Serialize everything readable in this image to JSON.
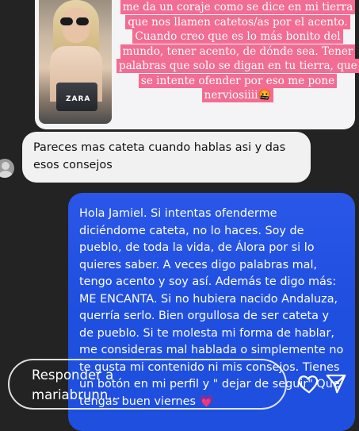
{
  "story_image": {
    "watermark": "ZARA",
    "overlay_text": "me da un coraje como se dice en mi tierra que nos llamen catetos/as por el acento. Cuando creo que es lo más bonito del mundo, tener acento, de dónde sea. Tener palabras que solo se digan en tu tierra, que se intente ofender por eso me pone nerviosiiii🤬"
  },
  "received_message": {
    "text": "Pareces mas cateta cuando hablas asi y das esos consejos"
  },
  "sent_message": {
    "text": "Hola Jamiel. Si intentas ofenderme diciéndome cateta, no lo haces. Soy de pueblo, de toda la vida, de Álora por si lo quieres saber. A veces digo palabras mal, tengo acento y soy así. Además te digo más: ME ENCANTA. Si no hubiera nacido Andaluza,  querría serlo. Bien orgullosa de ser cateta y de pueblo. Si te molesta mi forma de hablar, me consideras mal hablada o simplemente no te gusta mi contenido ni mis consejos. Tienes un botón en mi perfil y \" dejar de seguir\" Que tengas buen viernes 💗"
  },
  "reply_bar": {
    "placeholder": "Responder a mariabrunn..."
  },
  "icons": {
    "like": "heart-icon",
    "send": "paper-plane-icon",
    "avatar": "default-avatar-icon"
  },
  "colors": {
    "background": "#232323",
    "overlay_highlight": "#f26d93",
    "sent_bubble": "#1f4fdf",
    "received_bubble": "#f1f1f2"
  }
}
